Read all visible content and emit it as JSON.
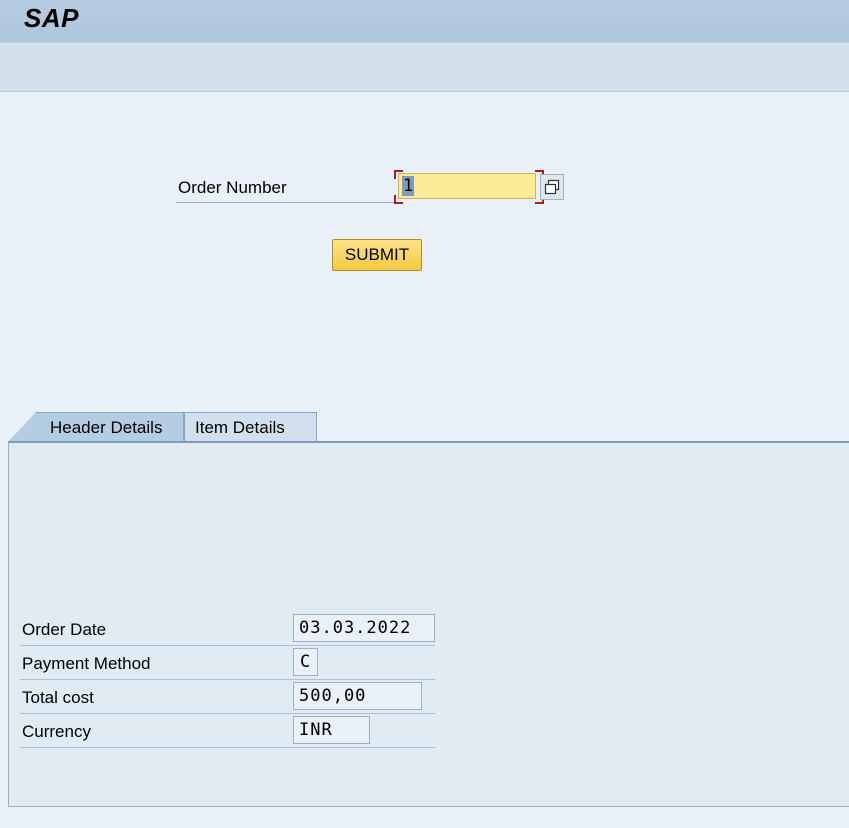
{
  "app": {
    "title": "SAP"
  },
  "selection": {
    "order_label": "Order Number",
    "order_value": "1",
    "submit_label": "SUBMIT"
  },
  "tabs": [
    {
      "label": "Header Details",
      "active": true
    },
    {
      "label": "Item Details",
      "active": false
    }
  ],
  "header_details": {
    "order_date_label": "Order Date",
    "order_date_value": "03.03.2022",
    "payment_method_label": "Payment Method",
    "payment_method_value": "C",
    "total_cost_label": "Total cost",
    "total_cost_value": "500,00",
    "currency_label": "Currency",
    "currency_value": "INR"
  },
  "colors": {
    "titlebar": "#b5cbe0",
    "input_highlight": "#fdeb99",
    "focus_corner": "#b01c1c",
    "submit_button": "#f5c841"
  },
  "icons": {
    "value_help": "value-help-icon"
  }
}
